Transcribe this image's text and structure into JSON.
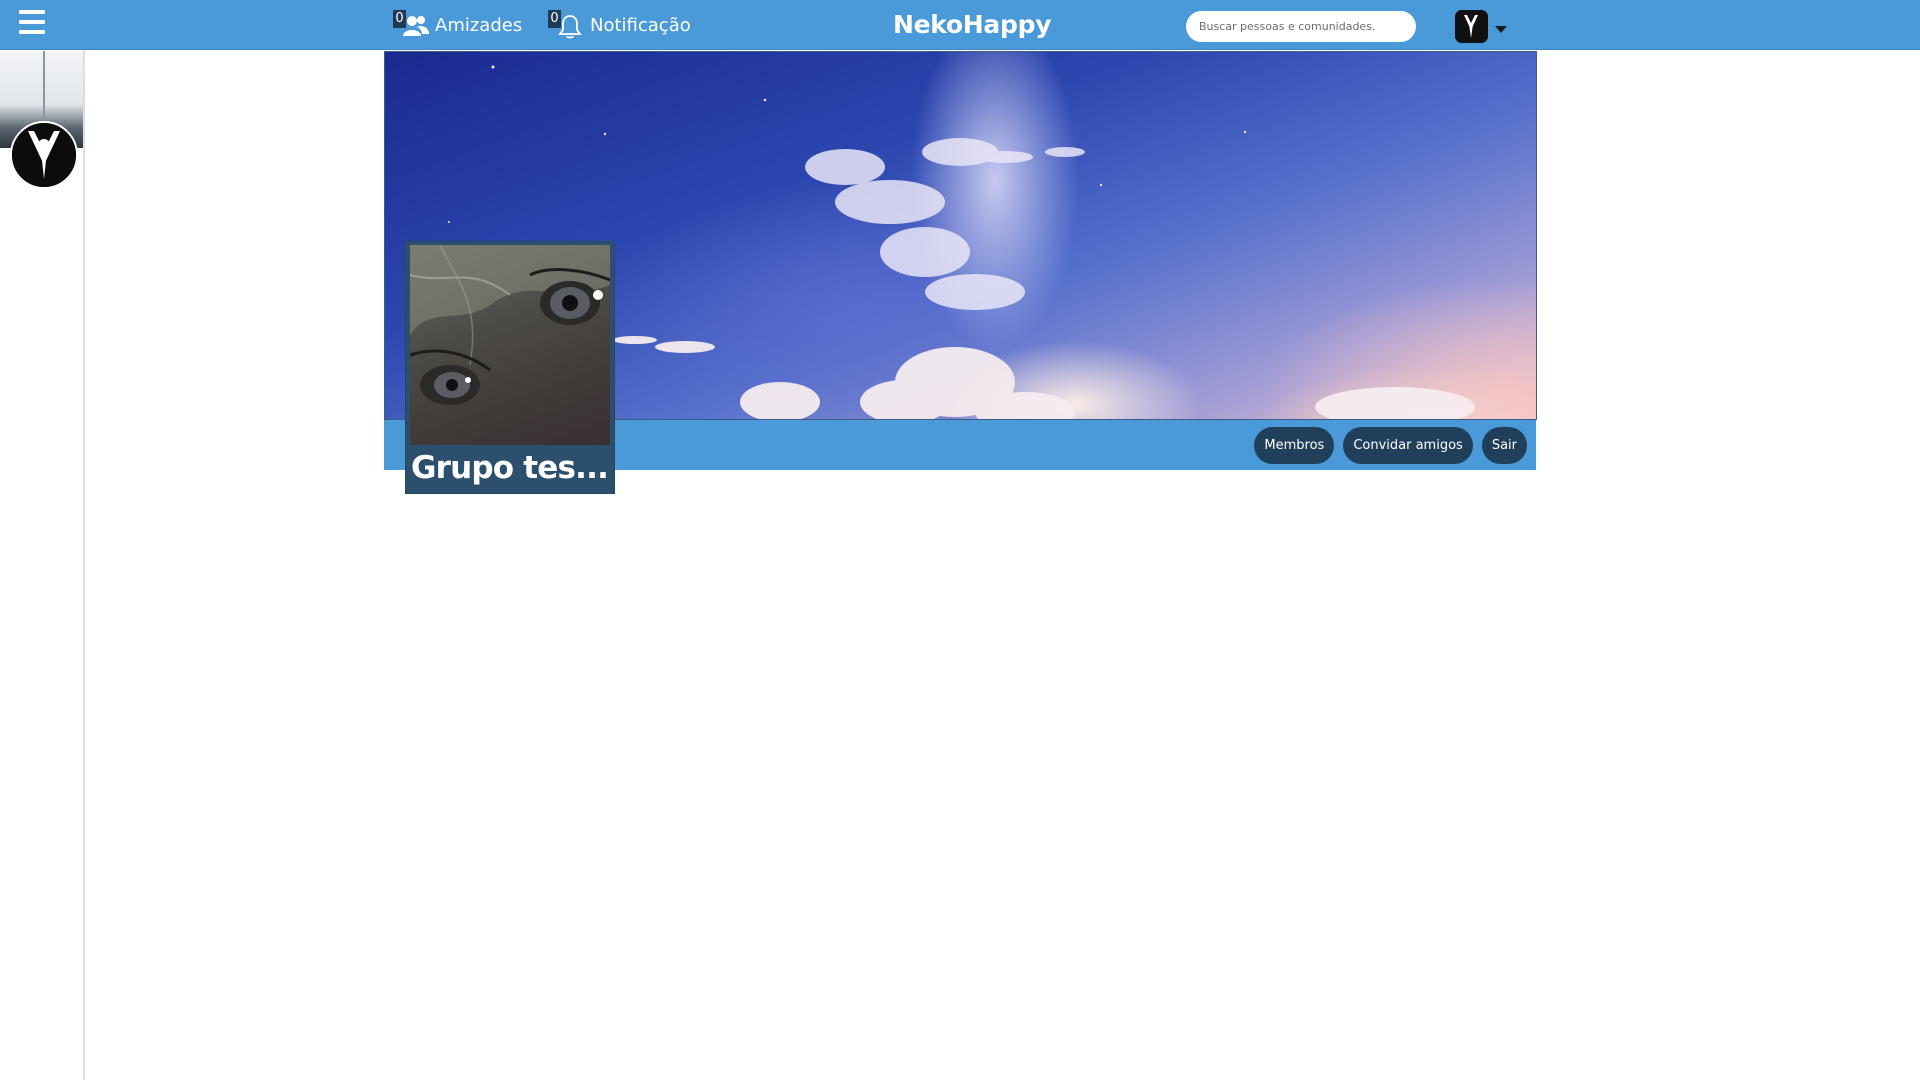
{
  "topbar": {
    "menu_icon": "hamburger-icon",
    "friends": {
      "count": "0",
      "label": "Amizades",
      "icon": "friends-icon"
    },
    "notifications": {
      "count": "0",
      "label": "Notificação",
      "icon": "bell-icon"
    },
    "brand": "NekoHappy",
    "search": {
      "placeholder": "Buscar pessoas e comunidades.",
      "value": ""
    },
    "user_menu_icon": "caret-down-icon"
  },
  "group": {
    "name": "Grupo tes...",
    "actions": {
      "members": "Membros",
      "invite": "Convidar amigos",
      "leave": "Sair"
    }
  },
  "colors": {
    "topbar": "#4a9ad9",
    "button_dark": "#203f5b",
    "avatar_box": "#2b4f6d"
  }
}
